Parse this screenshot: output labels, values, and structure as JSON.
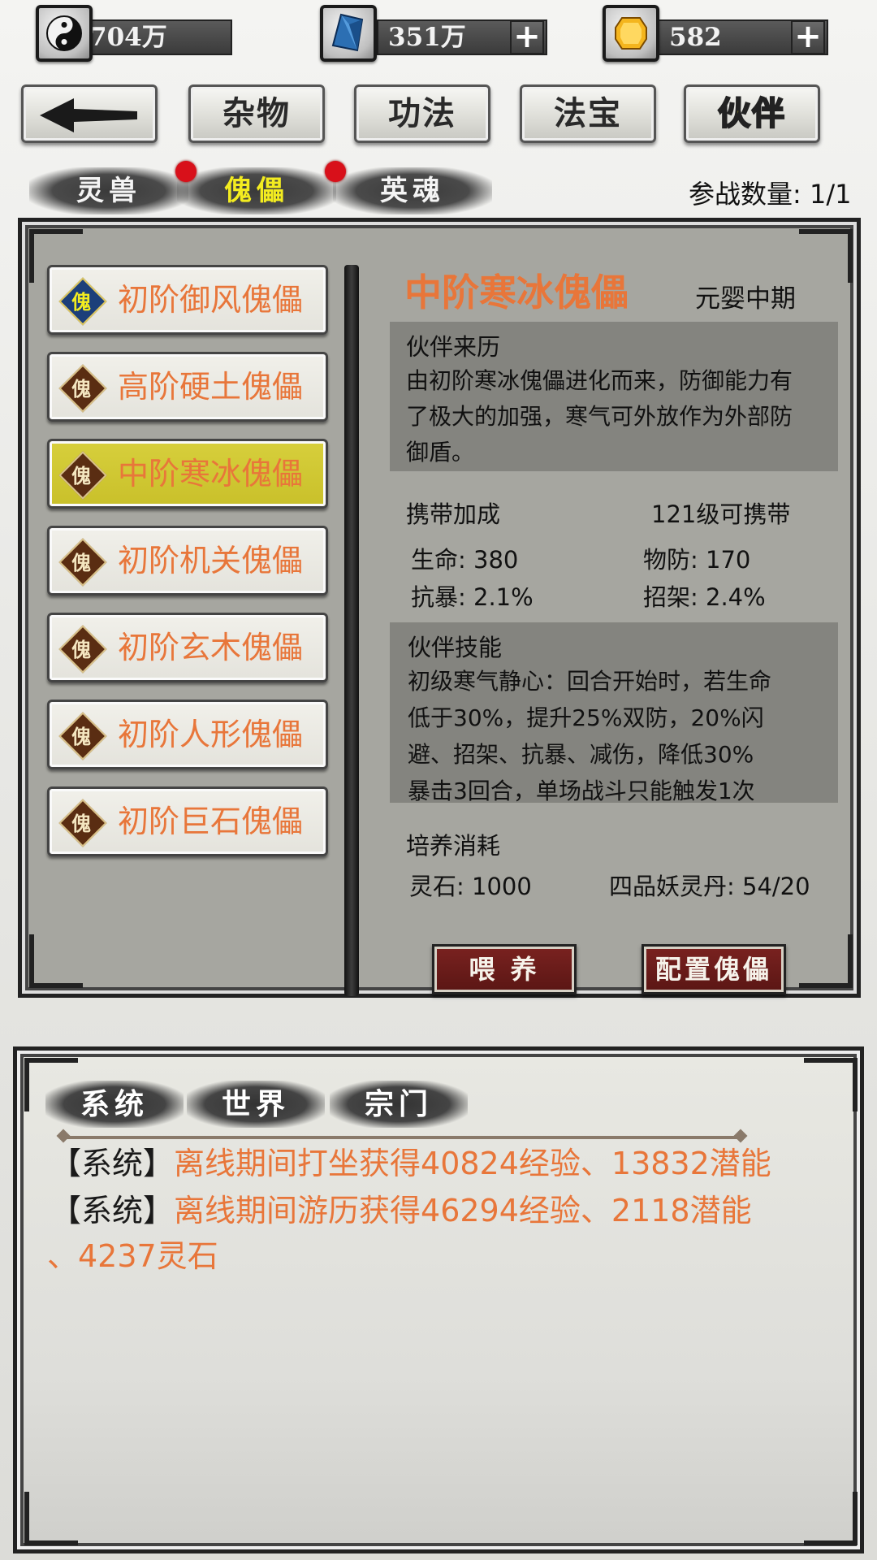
{
  "currencies": [
    {
      "icon": "yin-yang-icon",
      "value": "704万",
      "has_plus": false
    },
    {
      "icon": "blue-crystal-icon",
      "value": "351万",
      "has_plus": true
    },
    {
      "icon": "gold-gem-icon",
      "value": "582",
      "has_plus": true
    }
  ],
  "nav": {
    "back_icon": "back-arrow-icon",
    "buttons": [
      "杂物",
      "功法",
      "法宝",
      "伙伴"
    ],
    "active": "伙伴"
  },
  "subtabs": [
    "灵兽",
    "傀儡",
    "英魂"
  ],
  "active_subtab": "傀儡",
  "battle_count": "参战数量: 1/1",
  "puppet_list": [
    {
      "name": "初阶御风傀儡",
      "icon_char": "傀",
      "icon": "blue-puppet-icon",
      "selected": false
    },
    {
      "name": "高阶硬土傀儡",
      "icon_char": "傀",
      "icon": "brown-puppet-icon",
      "selected": false
    },
    {
      "name": "中阶寒冰傀儡",
      "icon_char": "傀",
      "icon": "brown-puppet-icon",
      "selected": true
    },
    {
      "name": "初阶机关傀儡",
      "icon_char": "傀",
      "icon": "brown-puppet-icon",
      "selected": false
    },
    {
      "name": "初阶玄木傀儡",
      "icon_char": "傀",
      "icon": "brown-puppet-icon",
      "selected": false
    },
    {
      "name": "初阶人形傀儡",
      "icon_char": "傀",
      "icon": "brown-puppet-icon",
      "selected": false
    },
    {
      "name": "初阶巨石傀儡",
      "icon_char": "傀",
      "icon": "brown-puppet-icon",
      "selected": false
    }
  ],
  "detail": {
    "name": "中阶寒冰傀儡",
    "realm": "元婴中期",
    "origin_title": "伙伴来历",
    "origin_lines": [
      "由初阶寒冰傀儡进化而来，防御能力有",
      "了极大的加强，寒气可外放作为外部防",
      "御盾。"
    ],
    "bonus_title": "携带加成",
    "carry_level": "121级可携带",
    "stats": [
      {
        "label": "生命: 380"
      },
      {
        "label": "物防: 170"
      },
      {
        "label": "抗暴: 2.1%"
      },
      {
        "label": "招架: 2.4%"
      }
    ],
    "skill_title": "伙伴技能",
    "skill_lines": [
      "初级寒气静心：回合开始时，若生命",
      "低于30%，提升25%双防，20%闪",
      "避、招架、抗暴、减伤，降低30%",
      "暴击3回合，单场战斗只能触发1次"
    ],
    "cost_title": "培养消耗",
    "cost_stone": "灵石: 1000",
    "cost_pill": "四品妖灵丹: 54/20",
    "feed_button": "喂 养",
    "config_button": "配置傀儡"
  },
  "chat": {
    "tabs": [
      "系统",
      "世界",
      "宗门"
    ],
    "lines": [
      {
        "tag": "【系统】",
        "msg": "离线期间打坐获得40824经验、13832潜能"
      },
      {
        "tag": "【系统】",
        "msg": "离线期间游历获得46294经验、2118潜能"
      },
      {
        "tag": "",
        "msg": "、4237灵石"
      }
    ]
  },
  "colors": {
    "accent_orange": "#e8763a",
    "active_yellow": "#f3ec20",
    "dark_red": "#6a1a18"
  }
}
